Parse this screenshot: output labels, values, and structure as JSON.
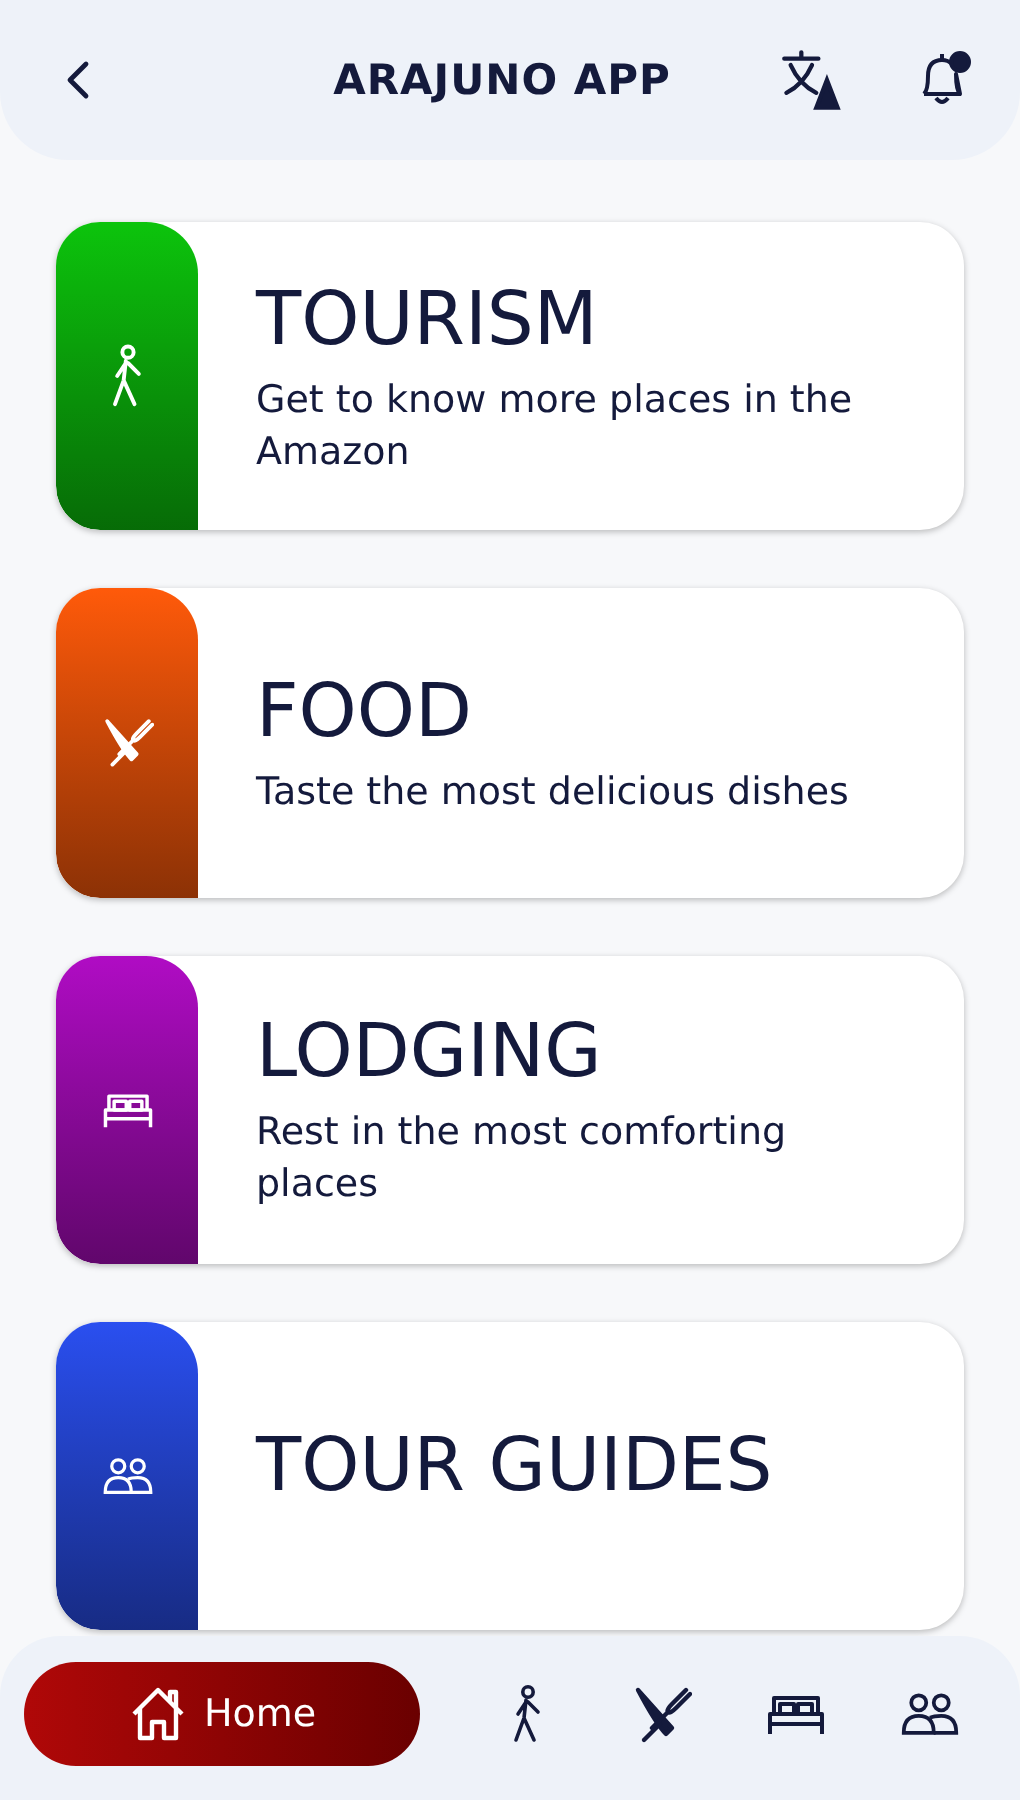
{
  "header": {
    "title": "ARAJUNO APP",
    "has_notification": true
  },
  "cards": [
    {
      "kind": "tourism",
      "color": "#0cc40c",
      "title": "TOURISM",
      "description": "Get to know more places in the Amazon"
    },
    {
      "kind": "food",
      "color": "#ff5a0a",
      "title": "FOOD",
      "description": "Taste the most delicious dishes"
    },
    {
      "kind": "lodging",
      "color": "#b00cc4",
      "title": "LODGING",
      "description": "Rest in the most comforting places"
    },
    {
      "kind": "guides",
      "color": "#2a4ff0",
      "title": "TOUR GUIDES"
    }
  ],
  "nav": [
    {
      "kind": "home",
      "label": "Home",
      "selected": true
    },
    {
      "kind": "tourism",
      "selected": false
    },
    {
      "kind": "food",
      "selected": false
    },
    {
      "kind": "lodging",
      "selected": false
    },
    {
      "kind": "guides",
      "selected": false
    }
  ]
}
